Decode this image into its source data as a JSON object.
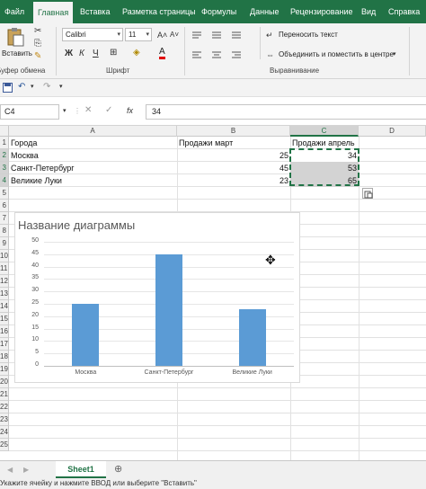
{
  "ribbon_tabs": [
    "Файл",
    "Главная",
    "Вставка",
    "Разметка страницы",
    "Формулы",
    "Данные",
    "Рецензирование",
    "Вид",
    "Справка"
  ],
  "ribbon": {
    "paste_label": "Вставить",
    "clipboard_label": "Буфер обмена",
    "font_name": "Calibri",
    "font_size": "11",
    "font_label": "Шрифт",
    "bold": "Ж",
    "italic": "К",
    "underline": "Ч",
    "grow_font": "A˄",
    "shrink_font": "A˅",
    "font_color_glyph": "A",
    "wrap_text": "Переносить текст",
    "merge_center": "Объединить и поместить в центре",
    "alignment_label": "Выравнивание"
  },
  "formula_bar": {
    "name_box": "C4",
    "fx": "fx",
    "value": "34"
  },
  "grid": {
    "columns": [
      "A",
      "B",
      "C",
      "D"
    ],
    "selected_column": "C",
    "rows": [
      "1",
      "2",
      "3",
      "4",
      "5",
      "6",
      "7",
      "8",
      "9",
      "10",
      "11",
      "12",
      "13",
      "14",
      "15",
      "16",
      "17",
      "18",
      "19",
      "20",
      "21",
      "22",
      "23",
      "24",
      "25"
    ],
    "selected_rows": [
      "2",
      "3",
      "4"
    ],
    "header_row": [
      "Города",
      "Продажи март",
      "Продажи апрель"
    ],
    "data_rows": [
      {
        "city": "Москва",
        "march": "25",
        "april": "34"
      },
      {
        "city": "Санкт-Петербург",
        "march": "45",
        "april": "53"
      },
      {
        "city": "Великие Луки",
        "march": "23",
        "april": "65"
      }
    ]
  },
  "chart_data": {
    "type": "bar",
    "title": "Название диаграммы",
    "categories": [
      "Москва",
      "Санкт-Петербург",
      "Великие Луки"
    ],
    "values": [
      25,
      45,
      23
    ],
    "ylim": [
      0,
      50
    ],
    "yticks": [
      "0",
      "5",
      "10",
      "15",
      "20",
      "25",
      "30",
      "35",
      "40",
      "45",
      "50"
    ],
    "grid": true,
    "bar_color": "#5b9bd5"
  },
  "sheet_tabs": [
    "Sheet1"
  ],
  "status_text": "Укажите ячейку и нажмите ВВОД или выберите \"Вставить\"",
  "colors": {
    "excel_green": "#217346",
    "bar": "#5b9bd5"
  }
}
